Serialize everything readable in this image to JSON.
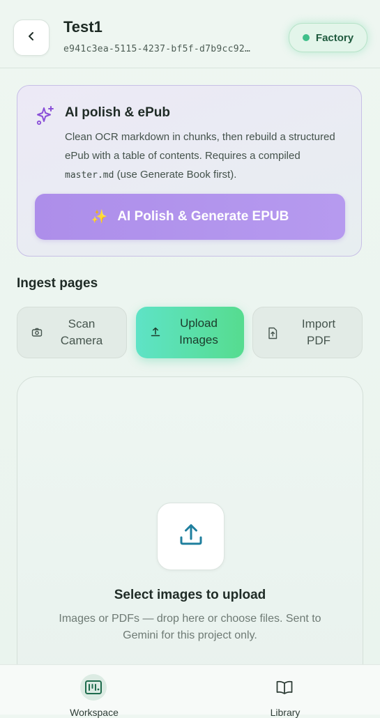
{
  "header": {
    "title": "Test1",
    "subtitle": "e941c3ea-5115-4237-bf5f-d7b9cc92…",
    "badge": "Factory"
  },
  "polish_card": {
    "title": "AI polish & ePub",
    "desc_part1": "Clean OCR markdown in chunks, then rebuild a structured ePub with a table of contents. Requires a compiled ",
    "desc_code": "master.md",
    "desc_part2": " (use Generate Book first).",
    "button_label": "AI Polish & Generate EPUB",
    "button_emoji": "✨"
  },
  "ingest": {
    "label": "Ingest pages",
    "tabs": [
      {
        "line1": "Scan",
        "line2": "Camera"
      },
      {
        "line1": "Upload",
        "line2": "Images"
      },
      {
        "line1": "Import",
        "line2": "PDF"
      }
    ],
    "active_tab": 1
  },
  "upload": {
    "title": "Select images to upload",
    "description": "Images or PDFs — drop here or choose files. Sent to Gemini for this project only."
  },
  "bottom_nav": {
    "items": [
      {
        "label": "Workspace",
        "icon": "workspace-icon",
        "active": true
      },
      {
        "label": "Library",
        "icon": "book-icon",
        "active": false
      }
    ]
  },
  "colors": {
    "accent_purple": "#ad8eea",
    "accent_green": "#56dc8f",
    "accent_teal": "#5ee3c6",
    "status_green": "#3fbf8a"
  }
}
